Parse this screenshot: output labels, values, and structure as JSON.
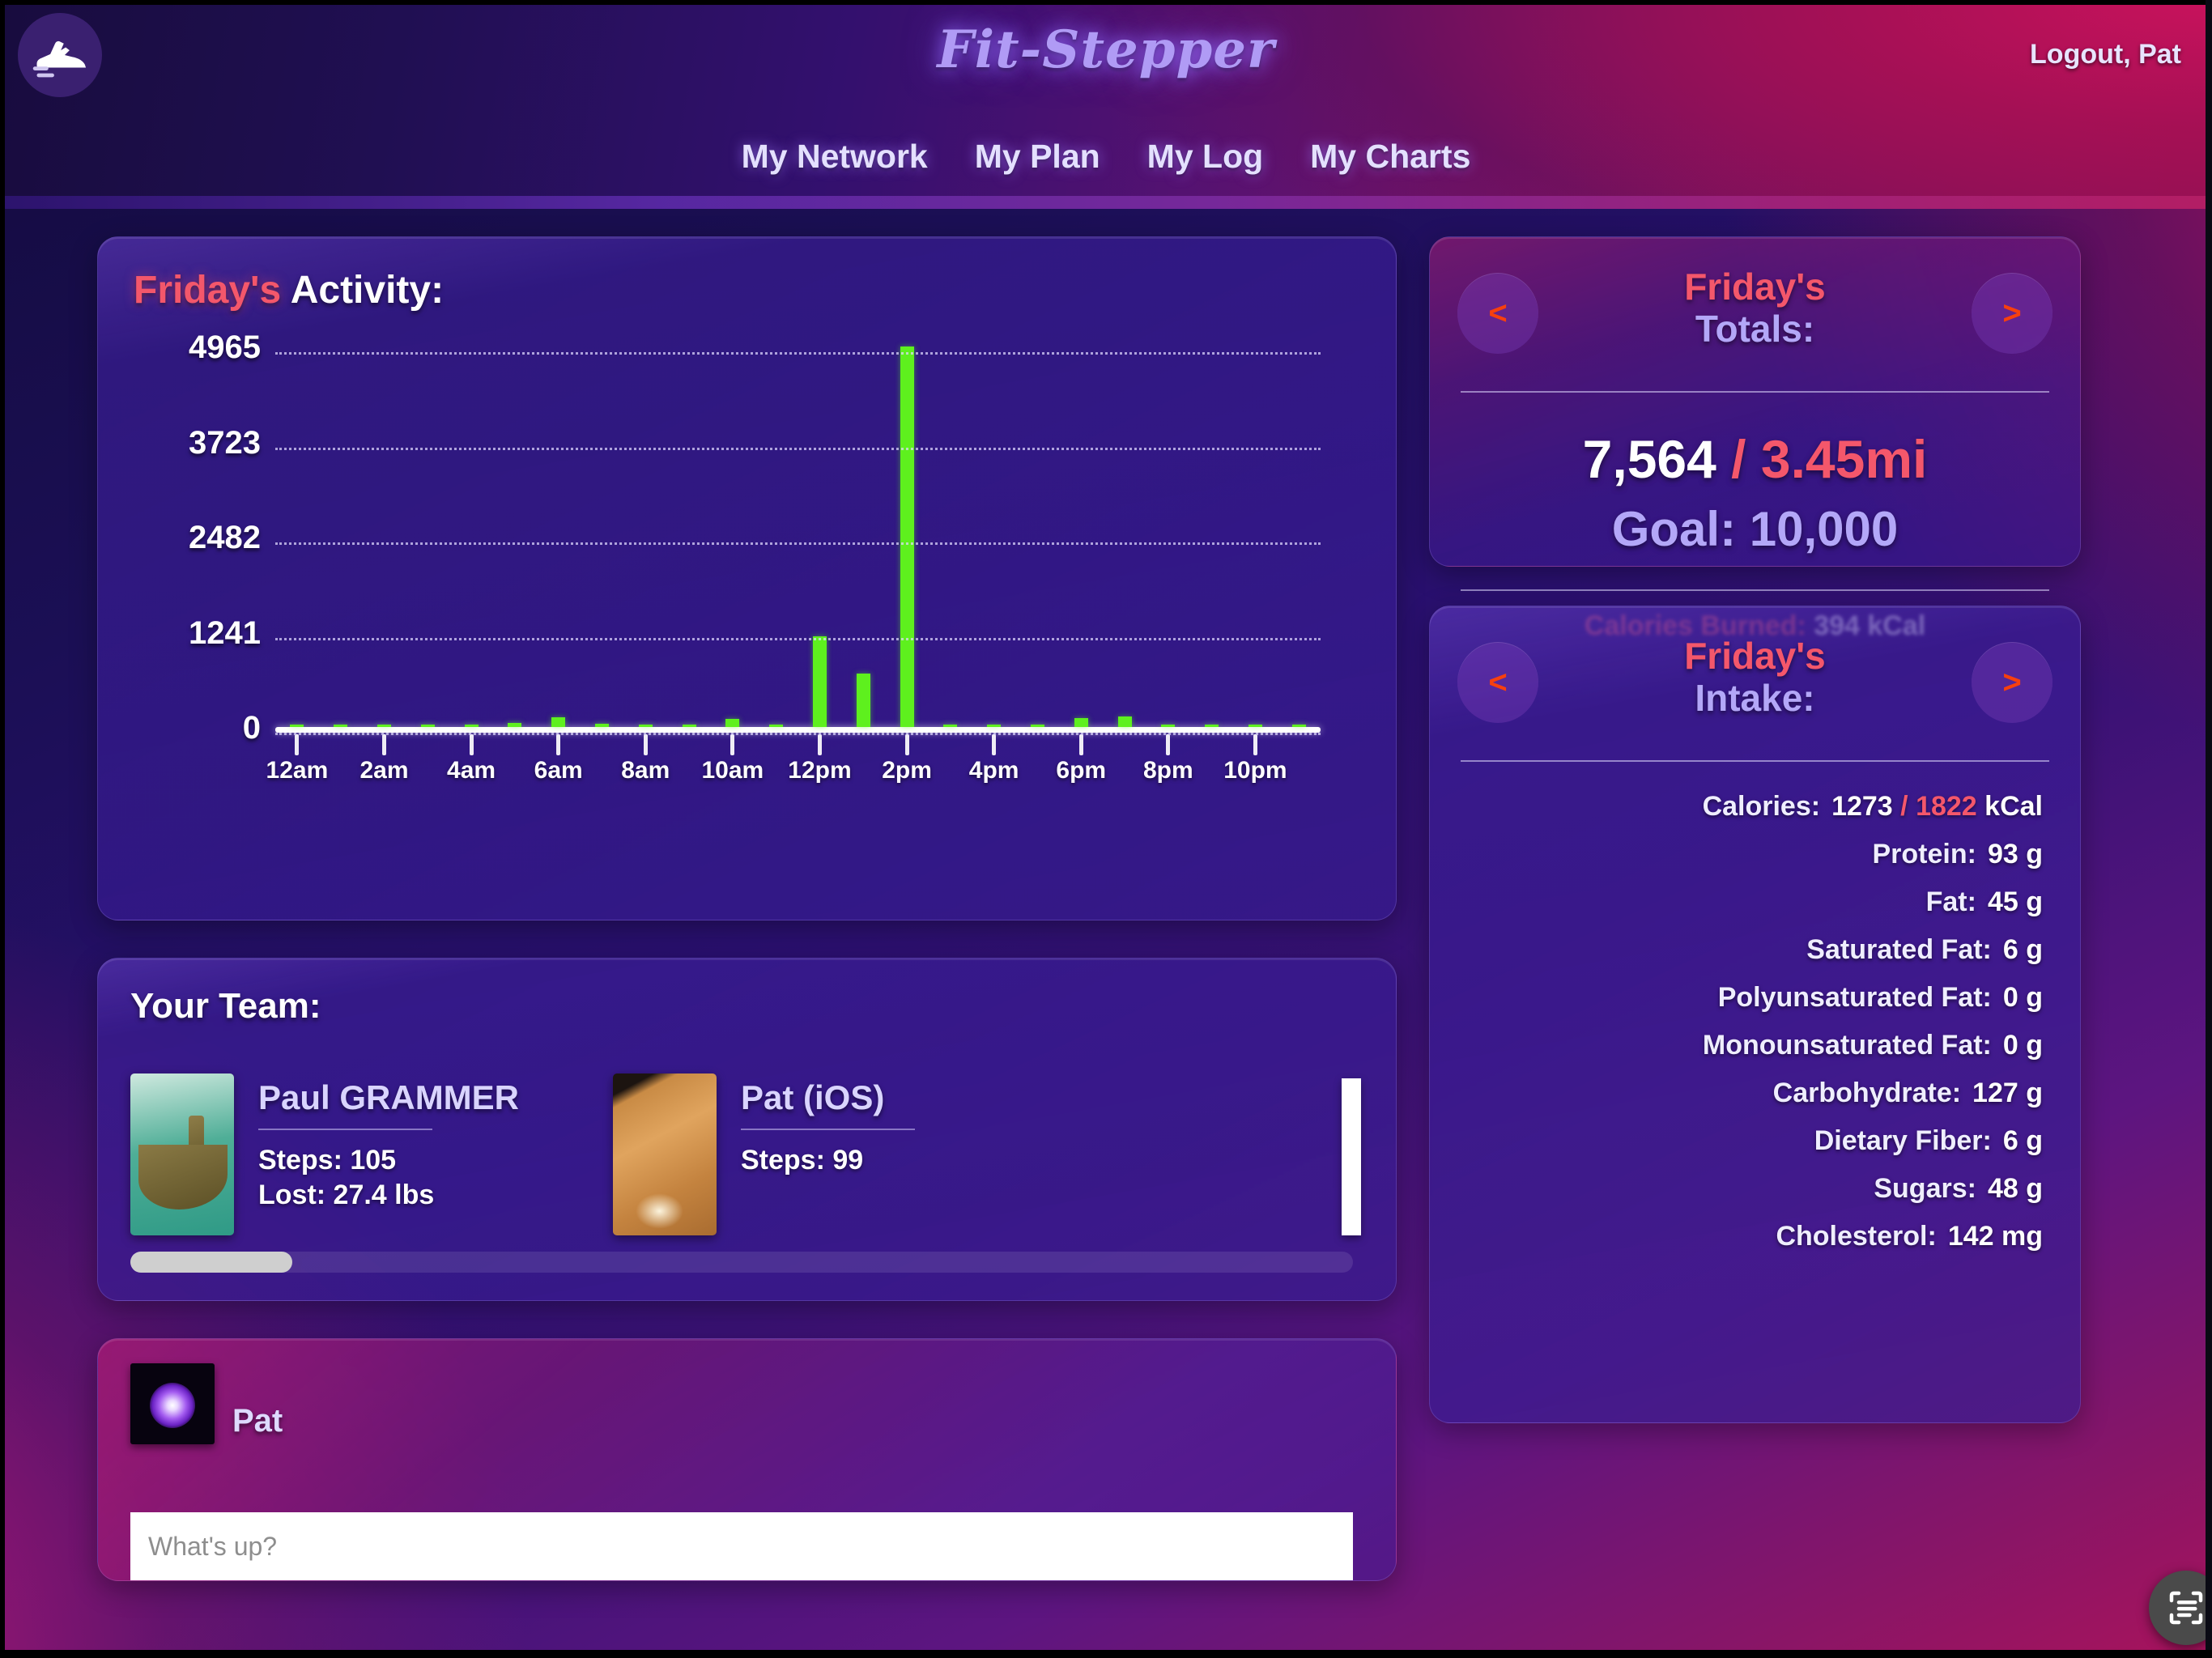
{
  "header": {
    "brand": "Fit-Stepper",
    "logo_icon": "running-shoe-icon",
    "logout": "Logout, Pat",
    "nav": [
      {
        "label": "My Network"
      },
      {
        "label": "My Plan"
      },
      {
        "label": "My Log"
      },
      {
        "label": "My Charts"
      }
    ]
  },
  "activity": {
    "title_day": "Friday's",
    "title_rest": " Activity:"
  },
  "chart_data": {
    "type": "bar",
    "title": "Friday's Activity:",
    "xlabel": "",
    "ylabel": "",
    "ylim": [
      0,
      4965
    ],
    "grid": true,
    "legend": "none",
    "bar_color": "#5ef01e",
    "yticks": [
      0,
      1241,
      2482,
      3723,
      4965
    ],
    "ytick_labels": [
      "0",
      "1241",
      "2482",
      "3723",
      "4965"
    ],
    "categories": [
      "12am",
      "1am",
      "2am",
      "3am",
      "4am",
      "5am",
      "6am",
      "7am",
      "8am",
      "9am",
      "10am",
      "11am",
      "12pm",
      "1pm",
      "2pm",
      "3pm",
      "4pm",
      "5pm",
      "6pm",
      "7pm",
      "8pm",
      "9pm",
      "10pm",
      "11pm"
    ],
    "xtick_labels": [
      "12am",
      "",
      "2am",
      "",
      "4am",
      "",
      "6am",
      "",
      "8am",
      "",
      "10am",
      "",
      "12pm",
      "",
      "2pm",
      "",
      "4pm",
      "",
      "6pm",
      "",
      "8pm",
      "",
      "10pm",
      ""
    ],
    "values": [
      22,
      26,
      24,
      30,
      28,
      55,
      130,
      38,
      32,
      36,
      110,
      30,
      1180,
      700,
      4965,
      26,
      24,
      28,
      120,
      135,
      30,
      28,
      26,
      24
    ]
  },
  "team": {
    "title": "Your Team:",
    "members": [
      {
        "name": "Paul GRAMMER",
        "avatar": "crocodile-photo",
        "steps_label": "Steps: 105",
        "lost_label": "Lost: 27.4 lbs"
      },
      {
        "name": "Pat (iOS)",
        "avatar": "wood-floor-photo",
        "steps_label": "Steps: 99",
        "lost_label": ""
      }
    ]
  },
  "post": {
    "author": "Pat",
    "avatar": "purple-glow-photo",
    "input_value": "",
    "input_placeholder": "What's up?"
  },
  "totals": {
    "prev_icon": "<",
    "next_icon": ">",
    "title_day": "Friday's",
    "title_rest": "Totals:",
    "steps": "7,564",
    "separator": "/",
    "distance": "3.45mi",
    "goal": "Goal: 10,000",
    "calories_label": "Calories Burned:",
    "calories_value": "394 kCal"
  },
  "intake": {
    "prev_icon": "<",
    "next_icon": ">",
    "title_day": "Friday's",
    "title_rest": "Intake:",
    "calories": {
      "label": "Calories:",
      "consumed": "1273",
      "separator": "/",
      "goal": "1822",
      "unit": "kCal"
    },
    "rows": [
      {
        "label": "Protein:",
        "value": "93 g"
      },
      {
        "label": "Fat:",
        "value": "45 g"
      },
      {
        "label": "Saturated Fat:",
        "value": "6 g"
      },
      {
        "label": "Polyunsaturated Fat:",
        "value": "0 g"
      },
      {
        "label": "Monounsaturated Fat:",
        "value": "0 g"
      },
      {
        "label": "Carbohydrate:",
        "value": "127 g"
      },
      {
        "label": "Dietary Fiber:",
        "value": "6 g"
      },
      {
        "label": "Sugars:",
        "value": "48 g"
      },
      {
        "label": "Cholesterol:",
        "value": "142 mg"
      }
    ]
  },
  "fab": {
    "icon": "scan-text-icon"
  },
  "colors": {
    "accent_pink": "#f4576b",
    "accent_lilac": "#b3a7f8",
    "bar_green": "#5ef01e",
    "arrow_orange": "#f7400e"
  }
}
